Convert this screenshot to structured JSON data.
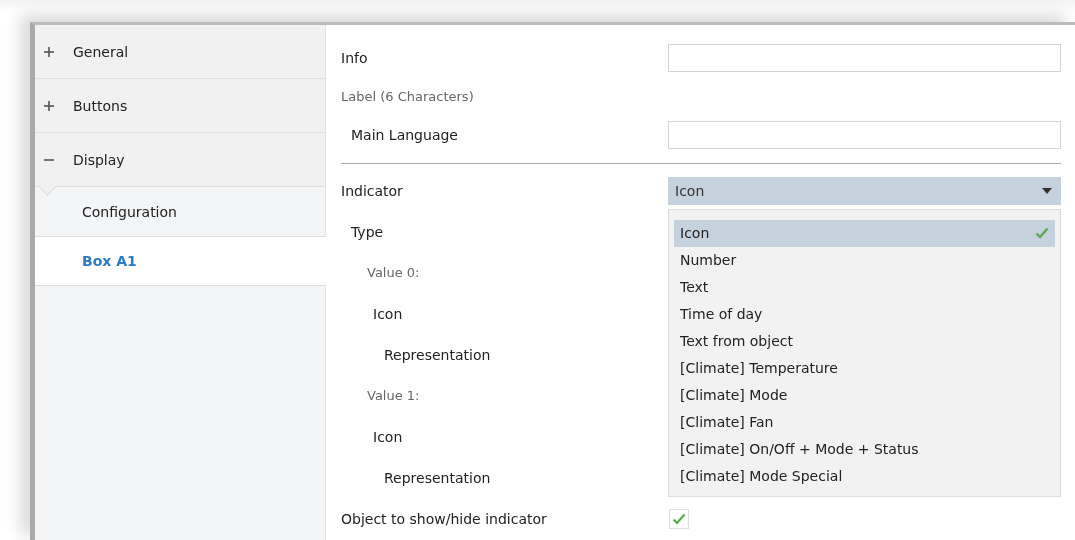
{
  "sidebar": {
    "items": [
      {
        "label": "General",
        "expanded": false
      },
      {
        "label": "Buttons",
        "expanded": false
      },
      {
        "label": "Display",
        "expanded": true,
        "children": [
          {
            "label": "Configuration",
            "selected": false
          },
          {
            "label": "Box A1",
            "selected": true
          }
        ]
      }
    ]
  },
  "parameters": [
    {
      "kind": "field",
      "label": "Info"
    },
    {
      "kind": "heading",
      "label": "Label (6 Characters)",
      "children": [
        {
          "kind": "field",
          "label": "Main Language"
        }
      ]
    },
    {
      "kind": "divider"
    },
    {
      "kind": "dropdown",
      "label": "Indicator",
      "value": "Icon",
      "expanded": true,
      "options": [
        {
          "label": "Icon",
          "selected": true
        },
        {
          "label": "Number",
          "selected": false
        },
        {
          "label": "Text",
          "selected": false
        },
        {
          "label": "Time of day",
          "selected": false
        },
        {
          "label": "Text from object",
          "selected": false
        },
        {
          "label": "[Climate] Temperature",
          "selected": false
        },
        {
          "label": "[Climate] Mode",
          "selected": false
        },
        {
          "label": "[Climate] Fan",
          "selected": false
        },
        {
          "label": "[Climate] On/Off + Mode + Status",
          "selected": false
        },
        {
          "label": "[Climate] Mode Special",
          "selected": false
        }
      ],
      "children": [
        {
          "kind": "label",
          "label": "Type",
          "children": [
            {
              "kind": "heading",
              "label": "Value 0:",
              "children": [
                {
                  "kind": "label",
                  "label": "Icon",
                  "children": [
                    {
                      "kind": "label",
                      "label": "Representation"
                    }
                  ]
                }
              ]
            },
            {
              "kind": "heading",
              "label": "Value 1:",
              "children": [
                {
                  "kind": "label",
                  "label": "Icon",
                  "children": [
                    {
                      "kind": "label",
                      "label": "Representation"
                    }
                  ]
                }
              ]
            }
          ]
        }
      ]
    },
    {
      "kind": "checkbox",
      "label": "Object to show/hide indicator",
      "checked": true
    }
  ]
}
